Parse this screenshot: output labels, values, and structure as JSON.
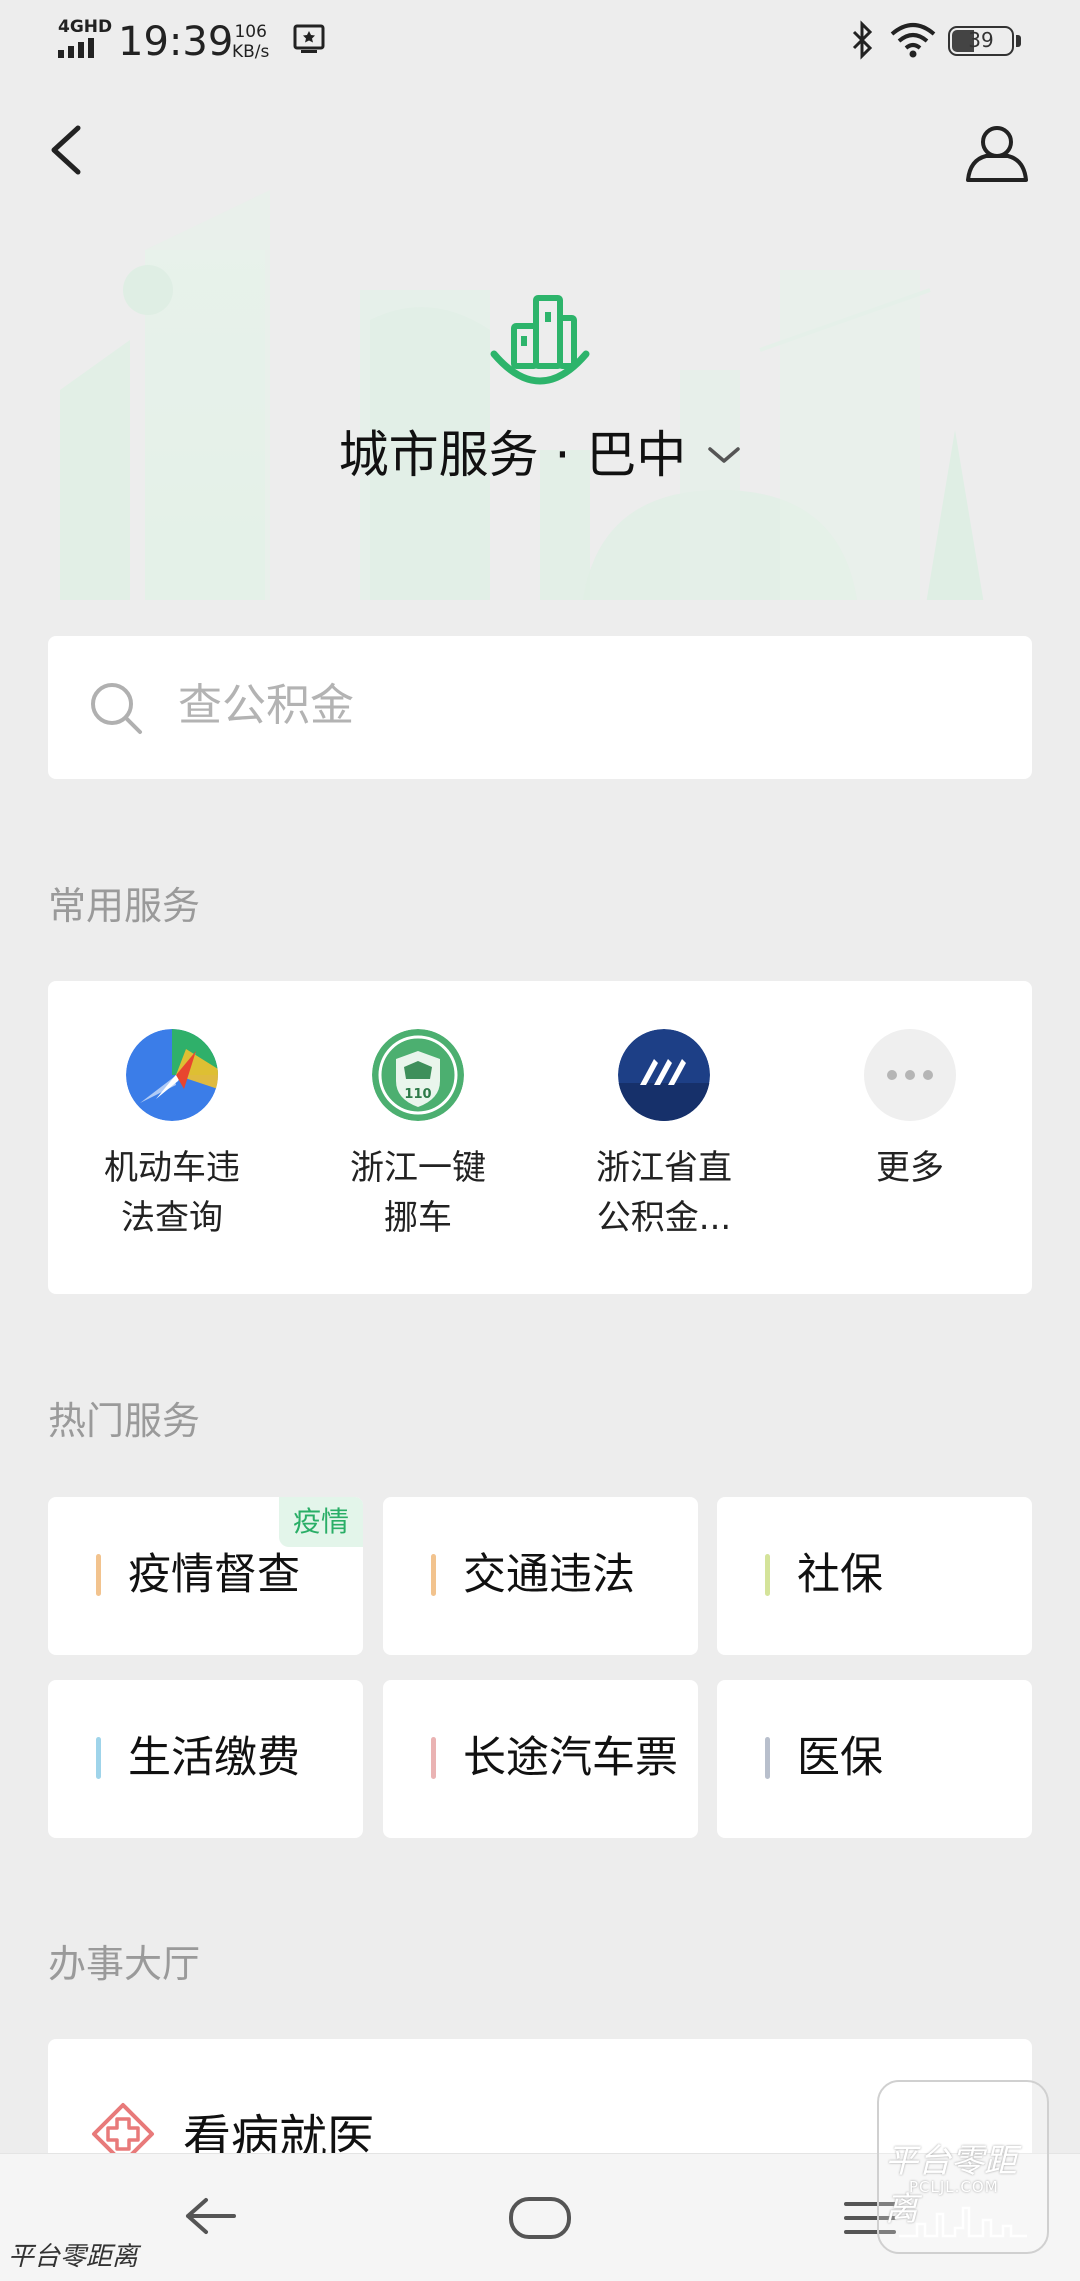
{
  "status_bar": {
    "network": "4GHD",
    "time": "19:39",
    "speed_value": "106",
    "speed_unit": "KB/s",
    "battery": "39"
  },
  "header": {
    "title": "城市服务 · 巴中",
    "icons": [
      "back-arrow-icon",
      "user-profile-icon",
      "city-buildings-icon",
      "chevron-down-icon"
    ]
  },
  "search": {
    "placeholder": "查公积金"
  },
  "common_services": {
    "title": "常用服务",
    "items": [
      {
        "label_line1": "机动车违",
        "label_line2": "法查询",
        "icon": "map-navigation-icon"
      },
      {
        "label_line1": "浙江一键",
        "label_line2": "挪车",
        "icon": "police-110-icon"
      },
      {
        "label_line1": "浙江省直",
        "label_line2": "公积金...",
        "icon": "housing-fund-icon"
      },
      {
        "label_line1": "更多",
        "label_line2": "",
        "icon": "more-dots-icon"
      }
    ]
  },
  "hot_services": {
    "title": "热门服务",
    "items": [
      {
        "label": "疫情督查",
        "tag": "疫情",
        "color": "#f2c38e"
      },
      {
        "label": "交通违法",
        "tag": "",
        "color": "#f2c38e"
      },
      {
        "label": "社保",
        "tag": "",
        "color": "#d4e39a"
      },
      {
        "label": "生活缴费",
        "tag": "",
        "color": "#9fd4ea"
      },
      {
        "label": "长途汽车票",
        "tag": "",
        "color": "#eab3b3"
      },
      {
        "label": "医保",
        "tag": "",
        "color": "#b8bfcc"
      }
    ]
  },
  "hall": {
    "title": "办事大厅",
    "first_item": "看病就医"
  },
  "watermark": {
    "left": "平台零距离",
    "box_line1": "平台零距离",
    "box_line2": "PCLJL.COM"
  },
  "colors": {
    "accent_green": "#2db46b",
    "background": "#ededed"
  }
}
